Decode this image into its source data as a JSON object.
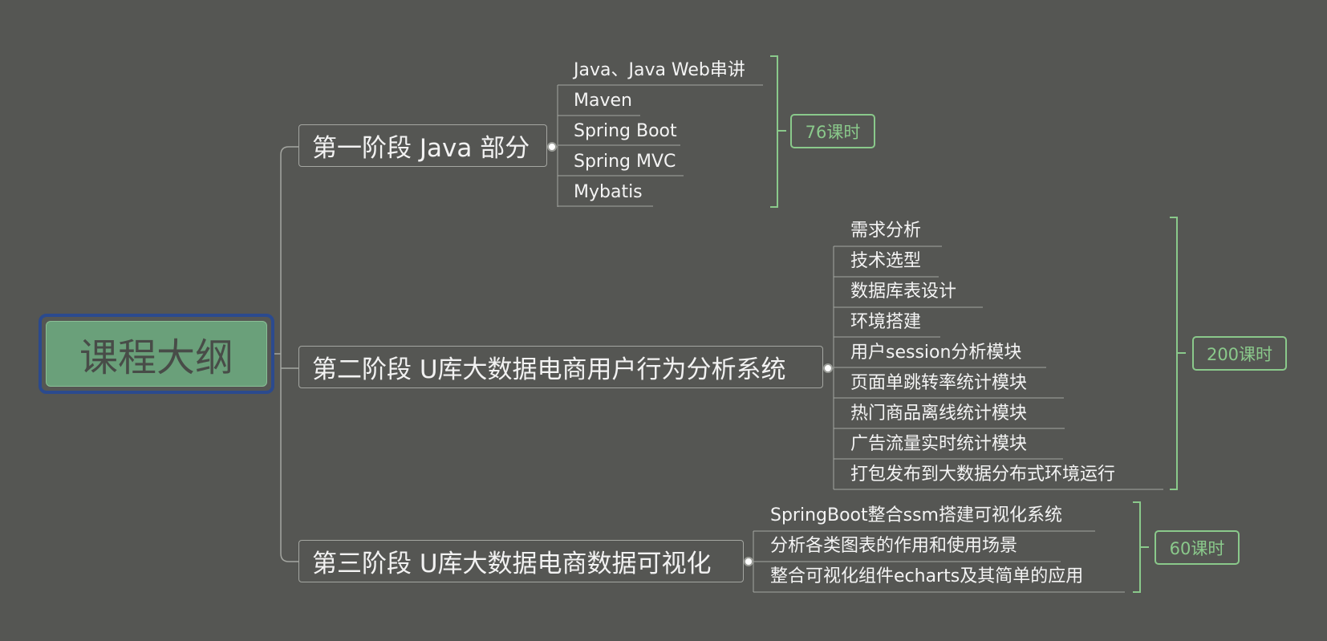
{
  "root": {
    "title": "课程大纲"
  },
  "stages": [
    {
      "title": "第一阶段 Java 部分",
      "hours": "76课时",
      "topics": [
        "Java、Java Web串讲",
        "Maven",
        "Spring Boot",
        "Spring MVC",
        "Mybatis"
      ]
    },
    {
      "title": "第二阶段 U库大数据电商用户行为分析系统",
      "hours": "200课时",
      "topics": [
        "需求分析",
        "技术选型",
        "数据库表设计",
        "环境搭建",
        "用户session分析模块",
        "页面单跳转率统计模块",
        "热门商品离线统计模块",
        "广告流量实时统计模块",
        "打包发布到大数据分布式环境运行"
      ]
    },
    {
      "title": "第三阶段 U库大数据电商数据可视化",
      "hours": "60课时",
      "topics": [
        "SpringBoot整合ssm搭建可视化系统",
        "分析各类图表的作用和使用场景",
        "整合可视化组件echarts及其简单的应用"
      ]
    }
  ],
  "colors": {
    "background": "#555653",
    "root_fill": "#6aa07a",
    "root_border": "#2b4a8e",
    "bracket": "#8ac98b",
    "connector": "#a4a6a1"
  }
}
